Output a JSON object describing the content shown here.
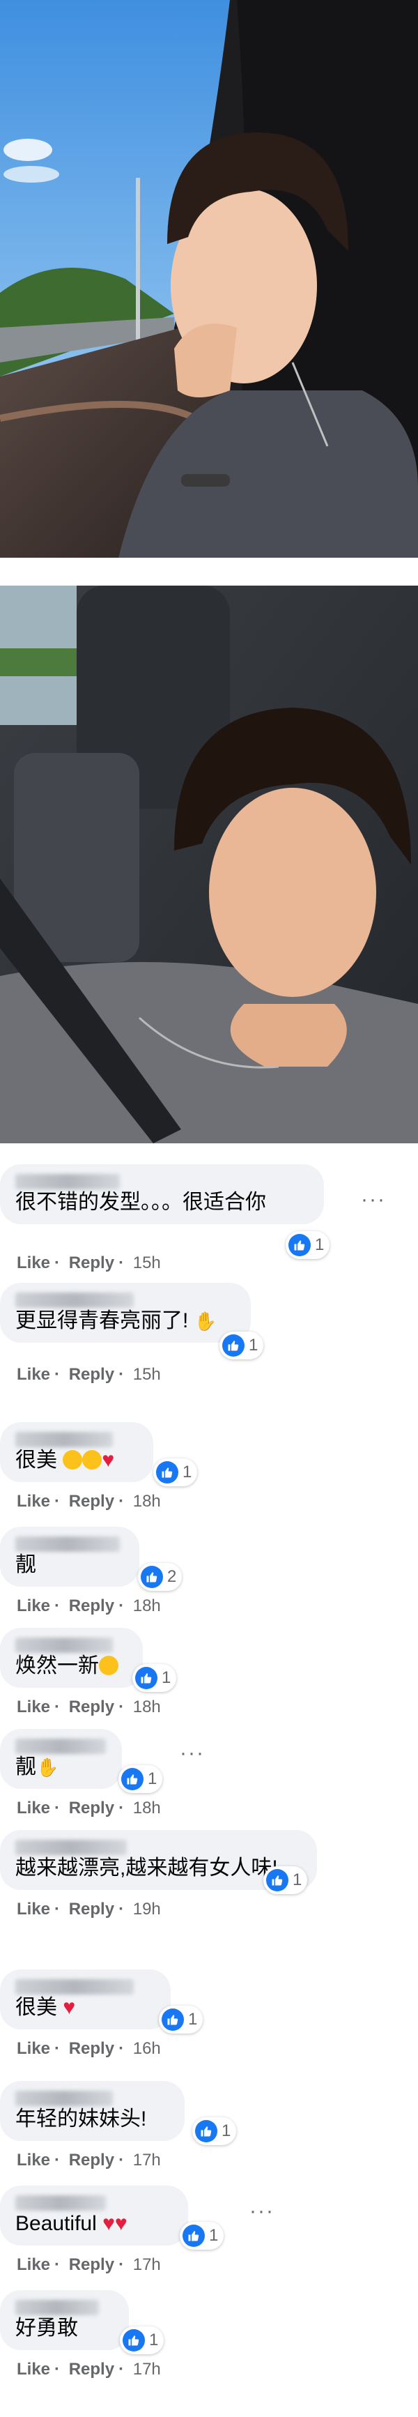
{
  "comments": [
    {
      "text": "很不错的发型。。。很适合你",
      "like": "Like",
      "reply": "Reply",
      "time": "15h",
      "reactions": "1"
    },
    {
      "text": "更显得青春亮丽了!",
      "like": "Like",
      "reply": "Reply",
      "time": "15h",
      "reactions": "1"
    },
    {
      "text": "很美",
      "like": "Like",
      "reply": "Reply",
      "time": "18h",
      "reactions": "1"
    },
    {
      "text": "靓",
      "like": "Like",
      "reply": "Reply",
      "time": "18h",
      "reactions": "2"
    },
    {
      "text": "焕然一新",
      "like": "Like",
      "reply": "Reply",
      "time": "18h",
      "reactions": "1"
    },
    {
      "text": "靓",
      "like": "Like",
      "reply": "Reply",
      "time": "18h",
      "reactions": "1"
    },
    {
      "text": "越来越漂亮,越来越有女人味!",
      "like": "Like",
      "reply": "Reply",
      "time": "19h",
      "reactions": "1"
    },
    {
      "text": "很美",
      "like": "Like",
      "reply": "Reply",
      "time": "16h",
      "reactions": "1"
    },
    {
      "text": "年轻的妹妹头!",
      "like": "Like",
      "reply": "Reply",
      "time": "17h",
      "reactions": "1"
    },
    {
      "text": "Beautiful",
      "like": "Like",
      "reply": "Reply",
      "time": "17h",
      "reactions": "1"
    },
    {
      "text": "好勇敢",
      "like": "Like",
      "reply": "Reply",
      "time": "17h",
      "reactions": "1"
    }
  ],
  "dots": "···",
  "colors": {
    "bubble": "#f0f2f5",
    "meta": "#65676b",
    "like_blue": "#1877f2",
    "heart": "#e41e3f"
  }
}
